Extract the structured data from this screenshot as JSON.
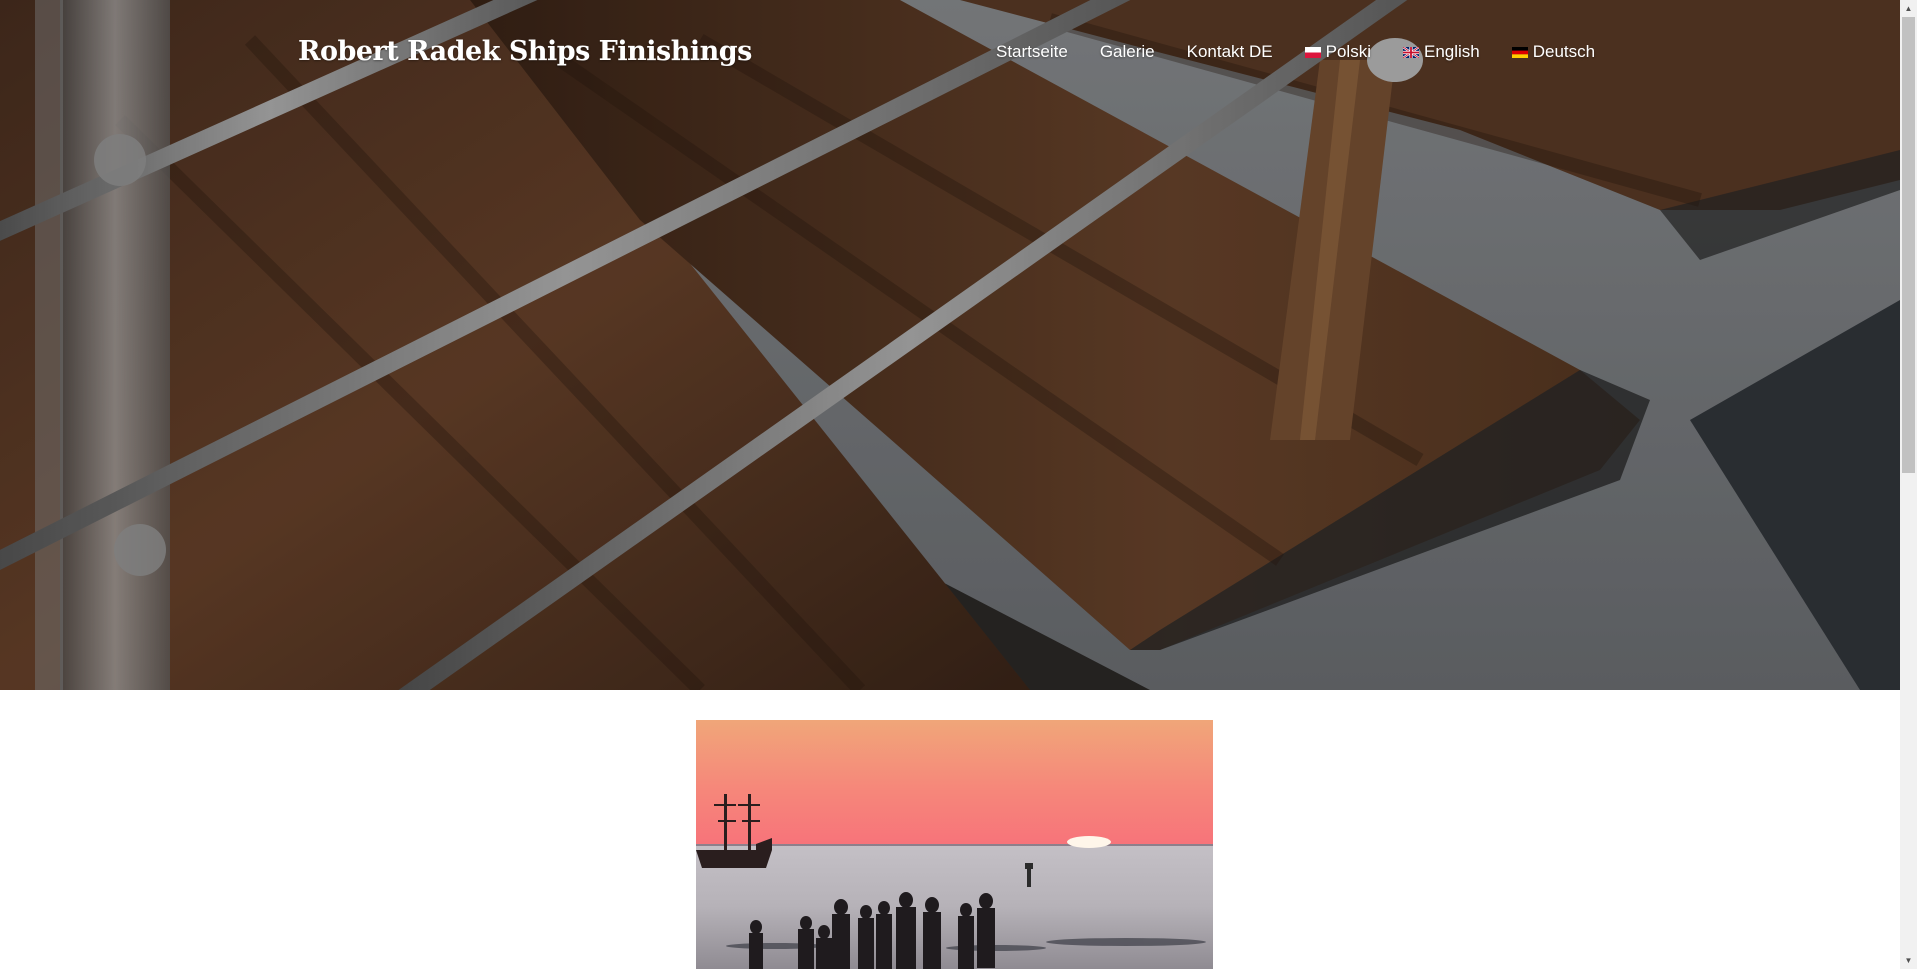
{
  "site": {
    "title": "Robert Radek Ships Finishings"
  },
  "nav": {
    "items": [
      {
        "label": "Startseite",
        "flag": null
      },
      {
        "label": "Galerie",
        "flag": null
      },
      {
        "label": "Kontakt DE",
        "flag": null
      },
      {
        "label": "Polski",
        "flag": "flag-poland-icon"
      },
      {
        "label": "English",
        "flag": "flag-uk-icon"
      },
      {
        "label": "Deutsch",
        "flag": "flag-germany-icon"
      }
    ]
  },
  "hero": {
    "image": "staircase-with-wooden-steps-and-steel-railing",
    "overlay_color": "#000000"
  },
  "content": {
    "image": "sunset-at-sea-with-sailing-ship-and-people-on-shore"
  },
  "colors": {
    "nav_text": "#ffffff",
    "page_background": "#ffffff",
    "scrollbar_track": "#f1f1f1",
    "scrollbar_thumb": "#c1c1c1"
  }
}
